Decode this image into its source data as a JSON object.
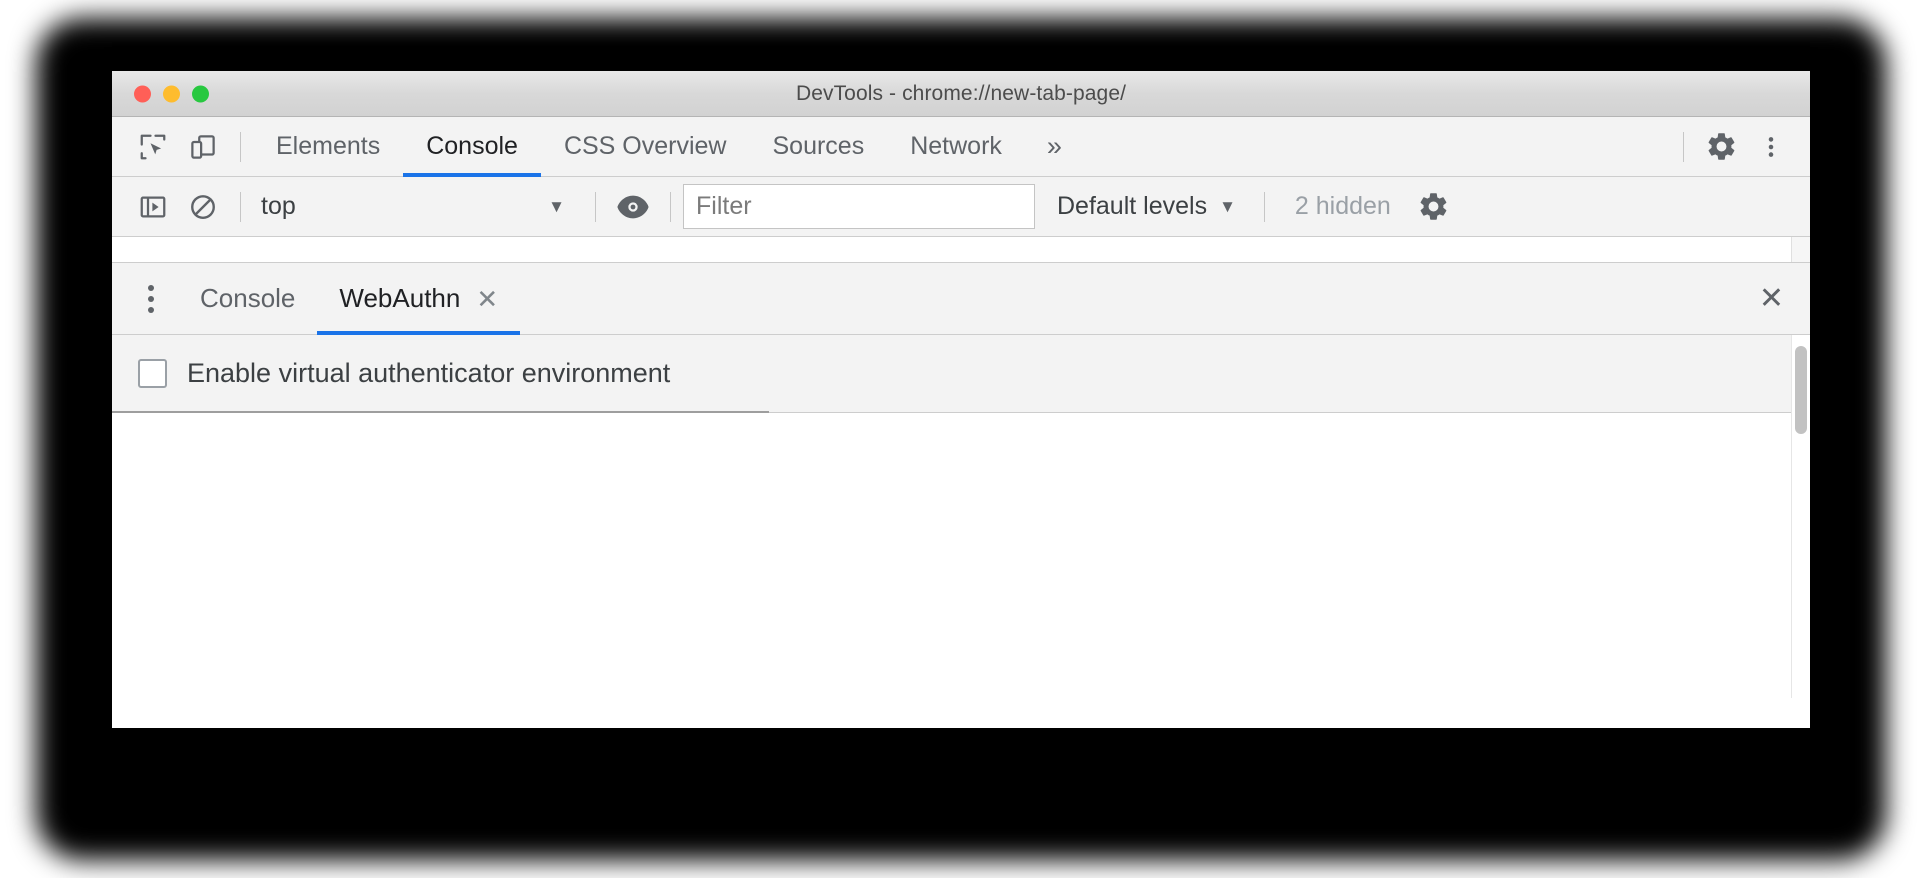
{
  "window": {
    "title": "DevTools - chrome://new-tab-page/",
    "traffic_lights": [
      {
        "name": "close",
        "color": "#ff5f57"
      },
      {
        "name": "minimize",
        "color": "#febc2e"
      },
      {
        "name": "zoom",
        "color": "#28c840"
      }
    ]
  },
  "main_toolbar": {
    "icons": [
      {
        "name": "inspect-element-icon",
        "title": "Inspect element"
      },
      {
        "name": "device-toolbar-icon",
        "title": "Toggle device toolbar"
      }
    ],
    "tabs": [
      {
        "label": "Elements",
        "active": false
      },
      {
        "label": "Console",
        "active": true
      },
      {
        "label": "CSS Overview",
        "active": false
      },
      {
        "label": "Sources",
        "active": false
      },
      {
        "label": "Network",
        "active": false
      }
    ],
    "more_tabs_label": "»",
    "right_icons": [
      {
        "name": "settings-gear-icon",
        "title": "Settings"
      },
      {
        "name": "more-options-kebab-icon",
        "title": "Customize and control DevTools"
      }
    ]
  },
  "console_toolbar": {
    "sidebar_toggle": {
      "name": "console-sidebar-icon",
      "title": "Show console sidebar"
    },
    "clear_console": {
      "name": "clear-console-icon",
      "title": "Clear console"
    },
    "context_value": "top",
    "context_arrow": "▼",
    "eye_icon": {
      "name": "live-expression-eye-icon",
      "title": "Create live expression"
    },
    "filter_placeholder": "Filter",
    "filter_value": "",
    "levels_label": "Default levels",
    "levels_arrow": "▼",
    "hidden_label": "2 hidden",
    "settings_icon": {
      "name": "console-settings-gear-icon",
      "title": "Console settings"
    }
  },
  "drawer": {
    "kebab_label": "More tools",
    "tabs": [
      {
        "label": "Console",
        "active": false,
        "closable": false
      },
      {
        "label": "WebAuthn",
        "active": true,
        "closable": true,
        "close_glyph": "✕"
      }
    ],
    "close_glyph": "✕"
  },
  "webauthn": {
    "enable_checkbox_label": "Enable virtual authenticator environment",
    "enable_checkbox_checked": false
  },
  "colors": {
    "accent_blue": "#1a73e8",
    "toolbar_bg": "#f3f3f3",
    "panel_bg": "#ffffff",
    "text_primary": "#202124",
    "text_secondary": "#5f6368",
    "text_muted": "#9aa0a6"
  }
}
